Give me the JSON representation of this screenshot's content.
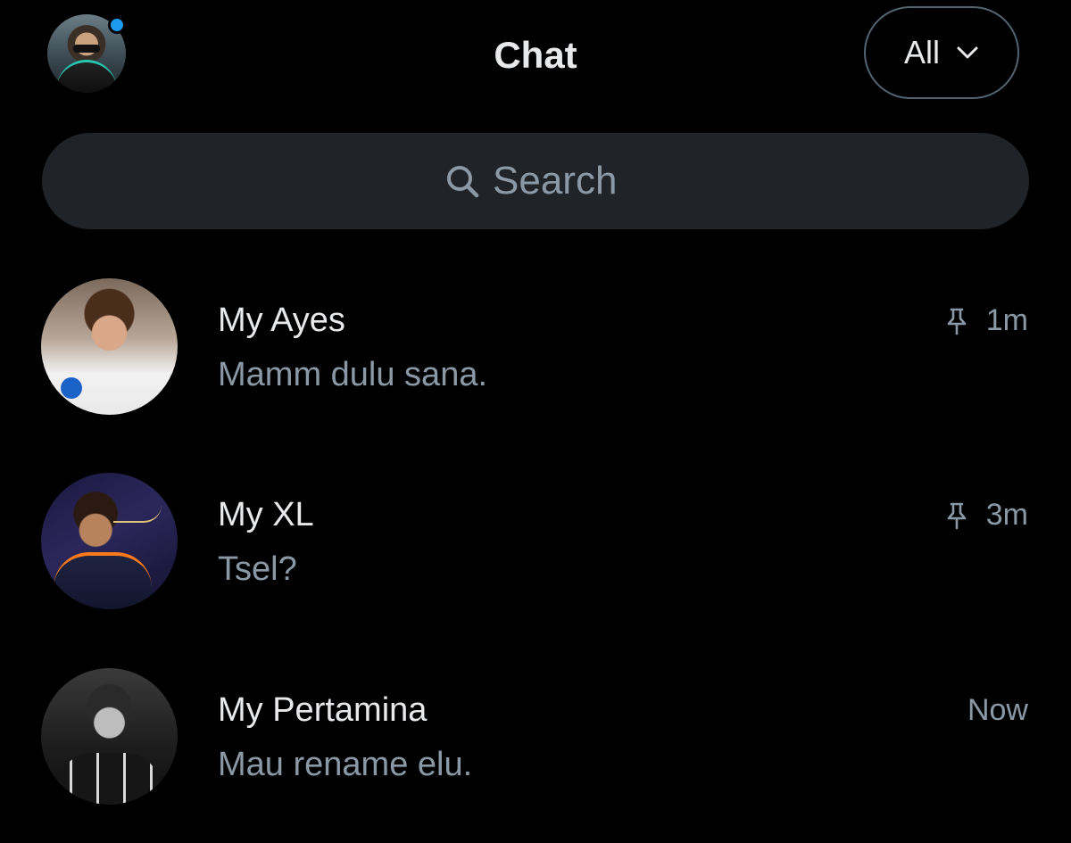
{
  "header": {
    "title": "Chat",
    "filter_label": "All",
    "filter_icon": "chevron-down-icon",
    "profile_avatar_icon": "user-avatar",
    "has_notification": true
  },
  "search": {
    "placeholder": "Search",
    "value": "",
    "icon": "search-icon"
  },
  "colors": {
    "background": "#000000",
    "text_primary": "#e7e9ea",
    "text_secondary": "#8b98a5",
    "search_background": "#202327",
    "accent": "#1d9bf0"
  },
  "chats": [
    {
      "name": "My Ayes",
      "preview": "Mamm dulu sana.",
      "time": "1m",
      "pinned": true
    },
    {
      "name": "My XL",
      "preview": "Tsel?",
      "time": "3m",
      "pinned": true
    },
    {
      "name": "My Pertamina",
      "preview": "Mau rename elu.",
      "time": "Now",
      "pinned": false
    }
  ]
}
